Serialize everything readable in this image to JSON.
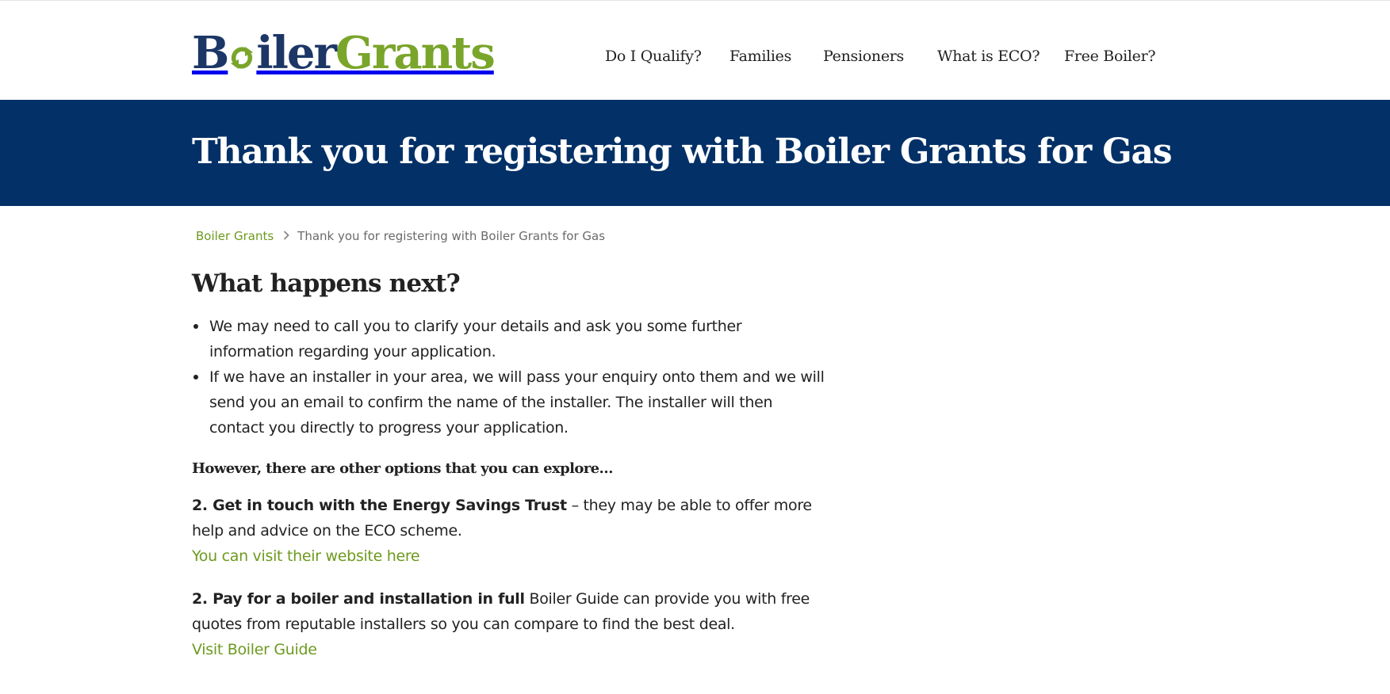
{
  "logo": {
    "part1": "B",
    "part2": "iler",
    "part3": "Grants",
    "colors": {
      "navy": "#1c3766",
      "green": "#7aa52b"
    },
    "icon": "recycle-arrows-icon"
  },
  "nav": {
    "items": [
      {
        "label": "Do I Qualify?"
      },
      {
        "label": "Families"
      },
      {
        "label": "Pensioners"
      },
      {
        "label": "What is ECO?"
      },
      {
        "label": "Free Boiler?"
      }
    ]
  },
  "banner": {
    "title": "Thank you for registering with Boiler Grants for Gas",
    "bg": "#023067"
  },
  "breadcrumb": {
    "home": "Boiler Grants",
    "current": "Thank you for registering with Boiler Grants for Gas",
    "separator_icon": "chevron-right-icon"
  },
  "main": {
    "heading": "What happens next?",
    "bullets": [
      "We may need to call you to clarify your details and ask you some further information regarding your application.",
      "If we have an installer in your area, we will pass your enquiry onto them and we will send you an email to confirm the name of the installer. The installer will then contact you directly to progress your application."
    ],
    "explore": "However, there are other options that you can explore…",
    "option1": {
      "bold": "2. Get in touch with the Energy Savings Trust",
      "text": " – they may be able to offer more help and advice on the ECO scheme.",
      "link": "You can visit their website here"
    },
    "option2": {
      "bold": "2. Pay for a boiler and installation in full",
      "text": " Boiler Guide can provide you with free quotes from reputable installers so you can compare to find the best deal.",
      "link": "Visit Boiler Guide"
    },
    "link_color": "#6d9a1f"
  }
}
